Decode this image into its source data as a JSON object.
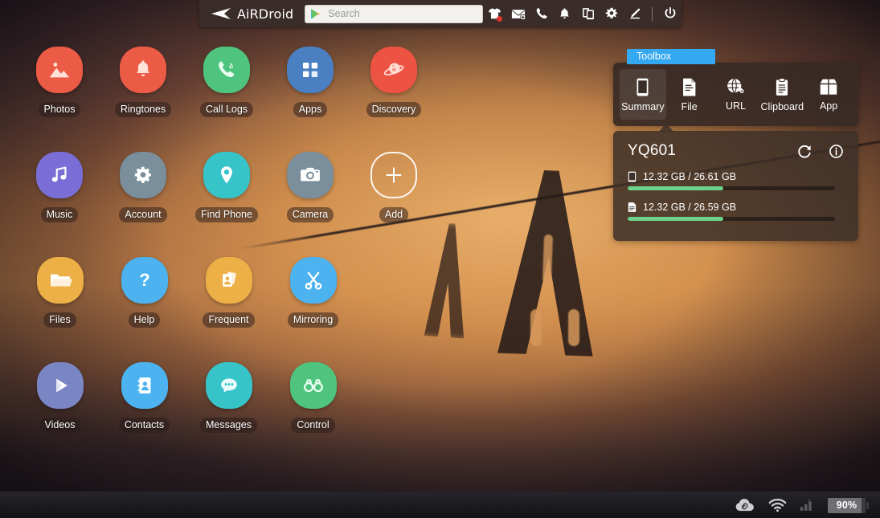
{
  "app": {
    "brand": "AiRDroid",
    "logo_icon": "airdroid-paperplane-icon"
  },
  "topbar": {
    "search": {
      "placeholder": "Search",
      "value": "",
      "leading_icon": "google-play-icon"
    },
    "icons": [
      {
        "name": "tshirt-icon",
        "label": "Themes",
        "badge": true
      },
      {
        "name": "mail-add-icon",
        "label": "Mail",
        "badge": false
      },
      {
        "name": "phone-icon",
        "label": "Call",
        "badge": false
      },
      {
        "name": "bell-icon",
        "label": "Notifications",
        "badge": false
      },
      {
        "name": "devices-icon",
        "label": "Devices",
        "badge": false
      },
      {
        "name": "gear-icon",
        "label": "Settings",
        "badge": false
      },
      {
        "name": "pencil-icon",
        "label": "Edit",
        "badge": false
      },
      {
        "name": "power-icon",
        "label": "Power",
        "badge": false
      }
    ]
  },
  "apps": [
    [
      {
        "label": "Photos",
        "icon": "photos-icon",
        "color": "#ec5b45"
      },
      {
        "label": "Ringtones",
        "icon": "bell-icon",
        "color": "#ec5b45"
      },
      {
        "label": "Call Logs",
        "icon": "phone-icon",
        "color": "#4fc47e"
      },
      {
        "label": "Apps",
        "icon": "apps-grid-icon",
        "color": "#4a7fc1"
      },
      {
        "label": "Discovery",
        "icon": "planet-icon",
        "color": "#ec5343"
      }
    ],
    [
      {
        "label": "Music",
        "icon": "music-note-icon",
        "color": "#7a6ed6"
      },
      {
        "label": "Account",
        "icon": "gear-icon",
        "color": "#7a8e9c"
      },
      {
        "label": "Find Phone",
        "icon": "map-pin-icon",
        "color": "#36c4c9"
      },
      {
        "label": "Camera",
        "icon": "camera-icon",
        "color": "#7a8e9c"
      },
      {
        "label": "Add",
        "icon": "plus-icon",
        "color": "transparent"
      }
    ],
    [
      {
        "label": "Files",
        "icon": "folder-icon",
        "color": "#edb046"
      },
      {
        "label": "Help",
        "icon": "question-icon",
        "color": "#4cb3f0"
      },
      {
        "label": "Frequent",
        "icon": "contact-cards-icon",
        "color": "#edb046"
      },
      {
        "label": "Mirroring",
        "icon": "scissors-icon",
        "color": "#4cb3f0"
      }
    ],
    [
      {
        "label": "Videos",
        "icon": "play-icon",
        "color": "#7a86c4"
      },
      {
        "label": "Contacts",
        "icon": "contact-book-icon",
        "color": "#4cb3f0"
      },
      {
        "label": "Messages",
        "icon": "chat-bubble-icon",
        "color": "#36c4c9"
      },
      {
        "label": "Control",
        "icon": "binoculars-icon",
        "color": "#4fc47e"
      }
    ]
  ],
  "toolbox": {
    "tab_label": "Toolbox",
    "tab_color": "#34a8f0",
    "items": [
      {
        "label": "Summary",
        "icon": "phone-outline-icon",
        "active": true
      },
      {
        "label": "File",
        "icon": "document-icon",
        "active": false
      },
      {
        "label": "URL",
        "icon": "globe-link-icon",
        "active": false
      },
      {
        "label": "Clipboard",
        "icon": "clipboard-icon",
        "active": false
      },
      {
        "label": "App",
        "icon": "box-open-icon",
        "active": false
      }
    ]
  },
  "device": {
    "name": "YQ601",
    "refresh_icon": "refresh-icon",
    "info_icon": "info-icon",
    "storage": [
      {
        "icon": "phone-storage-icon",
        "text": "12.32 GB / 26.61 GB",
        "percent": 46,
        "fill_color": "#6dd18a"
      },
      {
        "icon": "sdcard-icon",
        "text": "12.32 GB / 26.59 GB",
        "percent": 46,
        "fill_color": "#6dd18a"
      }
    ]
  },
  "statusbar": {
    "icons": [
      {
        "name": "cloud-link-icon",
        "label": "Cloud connected"
      },
      {
        "name": "wifi-icon",
        "label": "Wi-Fi"
      },
      {
        "name": "signal-bars-icon",
        "label": "Signal"
      }
    ],
    "battery": {
      "text": "90%",
      "percent": 90
    }
  }
}
